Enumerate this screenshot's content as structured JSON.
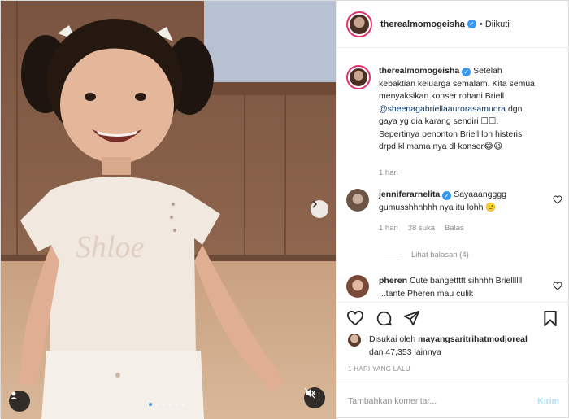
{
  "post": {
    "username": "therealmomogeisha",
    "follow_status": "• Diikuti",
    "media": {
      "icons": {
        "next": "chevron-right-icon",
        "tag": "user-tag-icon",
        "sound": "volume-mute-icon"
      },
      "carousel_count": 6,
      "carousel_active": 1
    },
    "caption": {
      "username": "therealmomogeisha",
      "text_before": "Setelah kebaktian keluarga semalam. Kita semua menyaksikan konser rohani Briell",
      "mention": "@sheenagabriellaaurorasamudra",
      "text_after": "dgn gaya yg dia karang sendiri ☐☐. Sepertinya penonton Briell lbh histeris drpd kl mama nya dl konser😂😆",
      "time": "1 hari"
    },
    "comments": [
      {
        "username": "jenniferarnelita",
        "verified": true,
        "text": "Sayaaangggg gumusshhhhhh nya itu lohh 🙂",
        "time": "1 hari",
        "likes": "38 suka",
        "reply": "Balas",
        "view_replies": "Lihat balasan (4)"
      },
      {
        "username": "pheren",
        "verified": false,
        "text": "Cute bangettttt sihhhh Briellllll ...tante Pheren mau culik"
      }
    ],
    "likes": {
      "prefix": "Disukai oleh",
      "liker": "mayangsaritrihatmodjoreal",
      "suffix": "dan 47,353 lainnya"
    },
    "time_ago": "1 HARI YANG LALU",
    "comment_input": {
      "placeholder": "Tambahkan komentar...",
      "value": ""
    },
    "post_button": "Kirim",
    "colors": {
      "accent": "#3897f0",
      "post_disabled": "#b2dffc",
      "muted": "#8e8e8e",
      "story_ring": "#e1306c"
    }
  }
}
